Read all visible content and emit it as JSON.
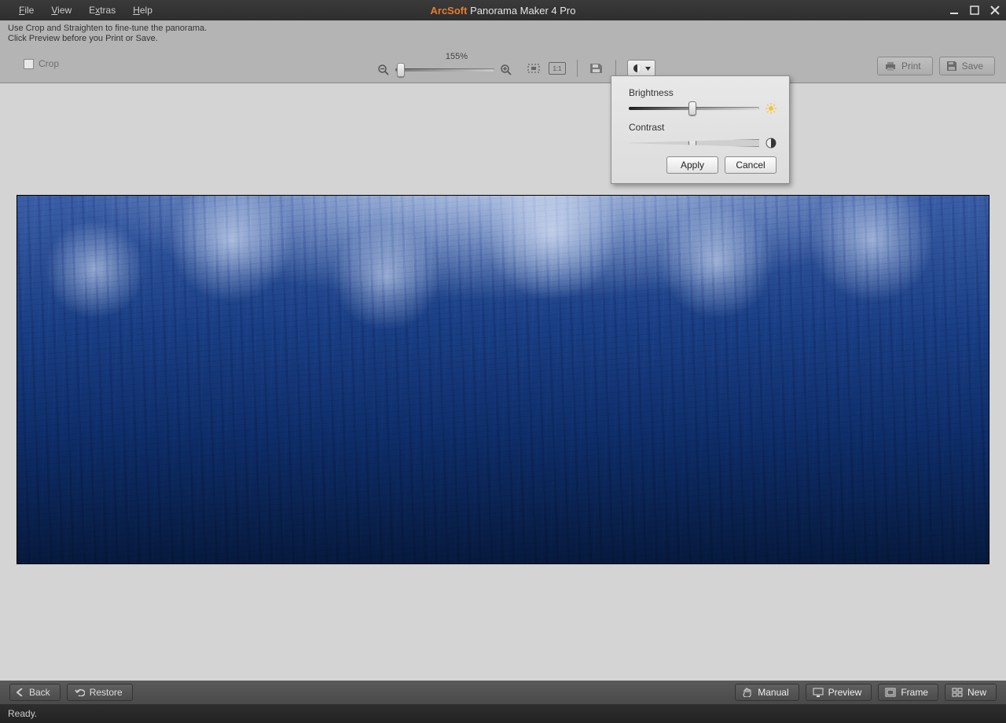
{
  "title": {
    "brand": "ArcSoft",
    "product": "Panorama Maker 4 Pro"
  },
  "menu": {
    "file": "File",
    "view": "View",
    "extras": "Extras",
    "help": "Help"
  },
  "hint": {
    "line1": "Use Crop and Straighten to fine-tune the panorama.",
    "line2": "Click Preview before you Print or Save."
  },
  "toolbar": {
    "crop_label": "Crop",
    "zoom_label": "155%",
    "ratio_label": "1:1",
    "print_label": "Print",
    "save_label": "Save"
  },
  "popup": {
    "brightness_label": "Brightness",
    "contrast_label": "Contrast",
    "brightness_pos_pct": 49,
    "contrast_pos_pct": 49,
    "apply_label": "Apply",
    "cancel_label": "Cancel"
  },
  "bottom": {
    "back": "Back",
    "restore": "Restore",
    "manual": "Manual",
    "preview": "Preview",
    "frame": "Frame",
    "new": "New"
  },
  "status": {
    "text": "Ready."
  }
}
